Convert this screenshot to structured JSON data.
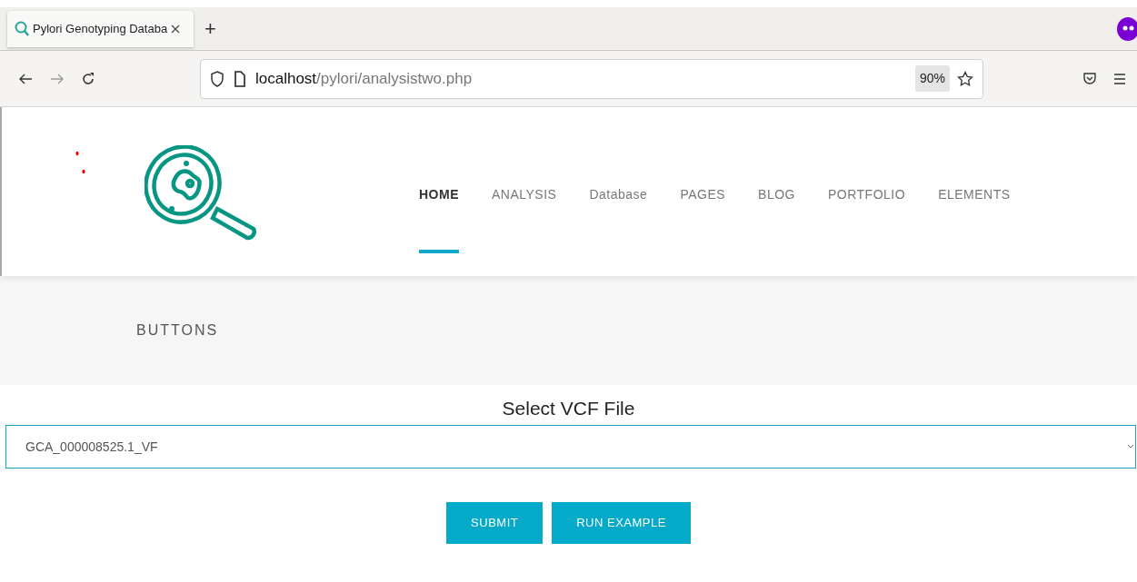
{
  "browser": {
    "tab": {
      "title": "Pylori Genotyping Databa",
      "selected": true
    },
    "new_tab": "+",
    "url": {
      "host": "localhost",
      "path": "/pylori/analysistwo.php"
    },
    "zoom": "90%"
  },
  "nav": [
    {
      "label": "HOME",
      "selected": true
    },
    {
      "label": "ANALYSIS",
      "selected": false
    },
    {
      "label": "Database",
      "selected": false
    },
    {
      "label": "PAGES",
      "selected": false
    },
    {
      "label": "BLOG",
      "selected": false
    },
    {
      "label": "PORTFOLIO",
      "selected": false
    },
    {
      "label": "ELEMENTS",
      "selected": false
    }
  ],
  "banner": {
    "title": "BUTTONS"
  },
  "form": {
    "label": "Select VCF File",
    "select_value": "GCA_000008525.1_VF",
    "buttons": [
      "SUBMIT",
      "RUN EXAMPLE"
    ]
  }
}
